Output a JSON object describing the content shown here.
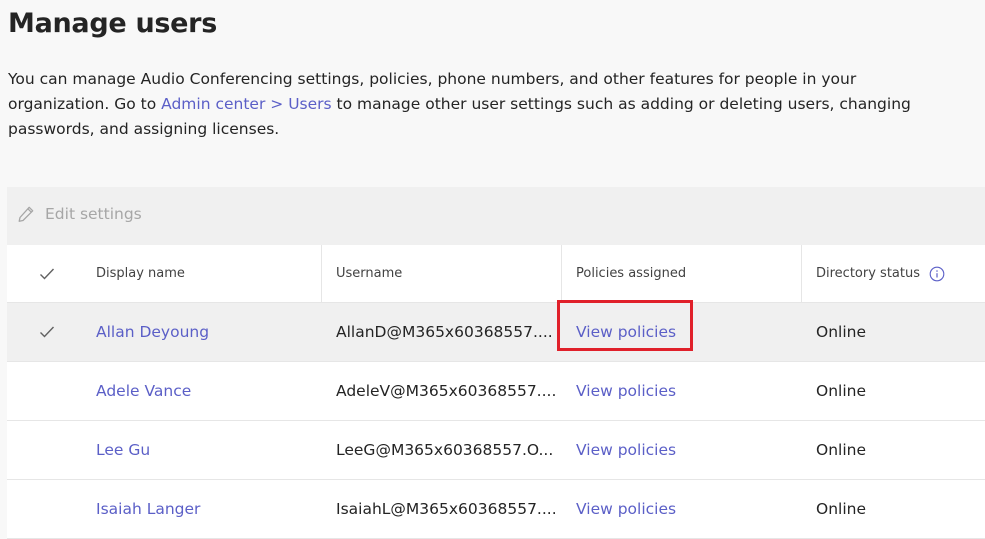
{
  "page": {
    "title": "Manage users",
    "intro_text_1": "You can manage Audio Conferencing settings, policies, phone numbers, and other features for people in your organization. Go to ",
    "link_admin_center": "Admin center",
    "link_separator": " > ",
    "link_users": "Users",
    "intro_text_2": " to manage other user settings such as adding or deleting users, changing passwords, and assigning licenses."
  },
  "toolbar": {
    "edit_label": "Edit settings",
    "edit_icon": "pencil-icon"
  },
  "table": {
    "columns": {
      "display_name": "Display name",
      "username": "Username",
      "policies": "Policies assigned",
      "directory_status": "Directory status"
    },
    "rows": [
      {
        "display_name": "Allan Deyoung",
        "username": "AllanD@M365x60368557....",
        "policies": "View policies",
        "status": "Online",
        "selected": true
      },
      {
        "display_name": "Adele Vance",
        "username": "AdeleV@M365x60368557....",
        "policies": "View policies",
        "status": "Online",
        "selected": false
      },
      {
        "display_name": "Lee Gu",
        "username": "LeeG@M365x60368557.O...",
        "policies": "View policies",
        "status": "Online",
        "selected": false
      },
      {
        "display_name": "Isaiah Langer",
        "username": "IsaiahL@M365x60368557....",
        "policies": "View policies",
        "status": "Online",
        "selected": false
      }
    ]
  },
  "colors": {
    "link": "#5b5fc7",
    "highlight_border": "#e0202a",
    "selected_row": "#f0f0f0"
  }
}
